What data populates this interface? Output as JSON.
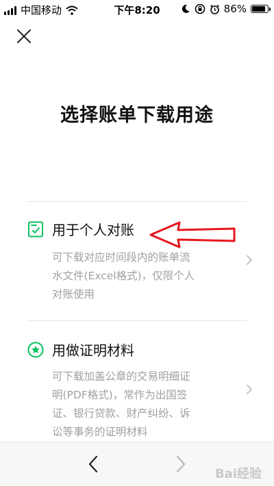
{
  "status_bar": {
    "carrier": "中国移动",
    "time": "下午8:20",
    "battery": "86%",
    "battery_level": 0.86
  },
  "header": {
    "close_icon": "close-icon"
  },
  "page": {
    "title": "选择账单下载用途"
  },
  "options": [
    {
      "icon": "receipt-check-icon",
      "title": "用于个人对账",
      "description_lines": [
        "可下载对应时间段内的账单流",
        "水文件(Excel格式)，仅限个人",
        "对账使用"
      ]
    },
    {
      "icon": "star-badge-icon",
      "title": "用做证明材料",
      "description_lines": [
        "可下载加盖公章的交易明细证",
        "明(PDF格式)，常作为出国签",
        "证、银行贷款、财产纠纷、诉",
        "讼等事务的证明材料"
      ]
    }
  ],
  "colors": {
    "accent": "#07c160",
    "annotation": "#e8151c",
    "secondary_text": "#a0a0a0"
  },
  "bottom_bar": {
    "back_icon": "chevron-left-icon",
    "forward_icon": "chevron-right-icon",
    "watermark": "Bai经验"
  }
}
